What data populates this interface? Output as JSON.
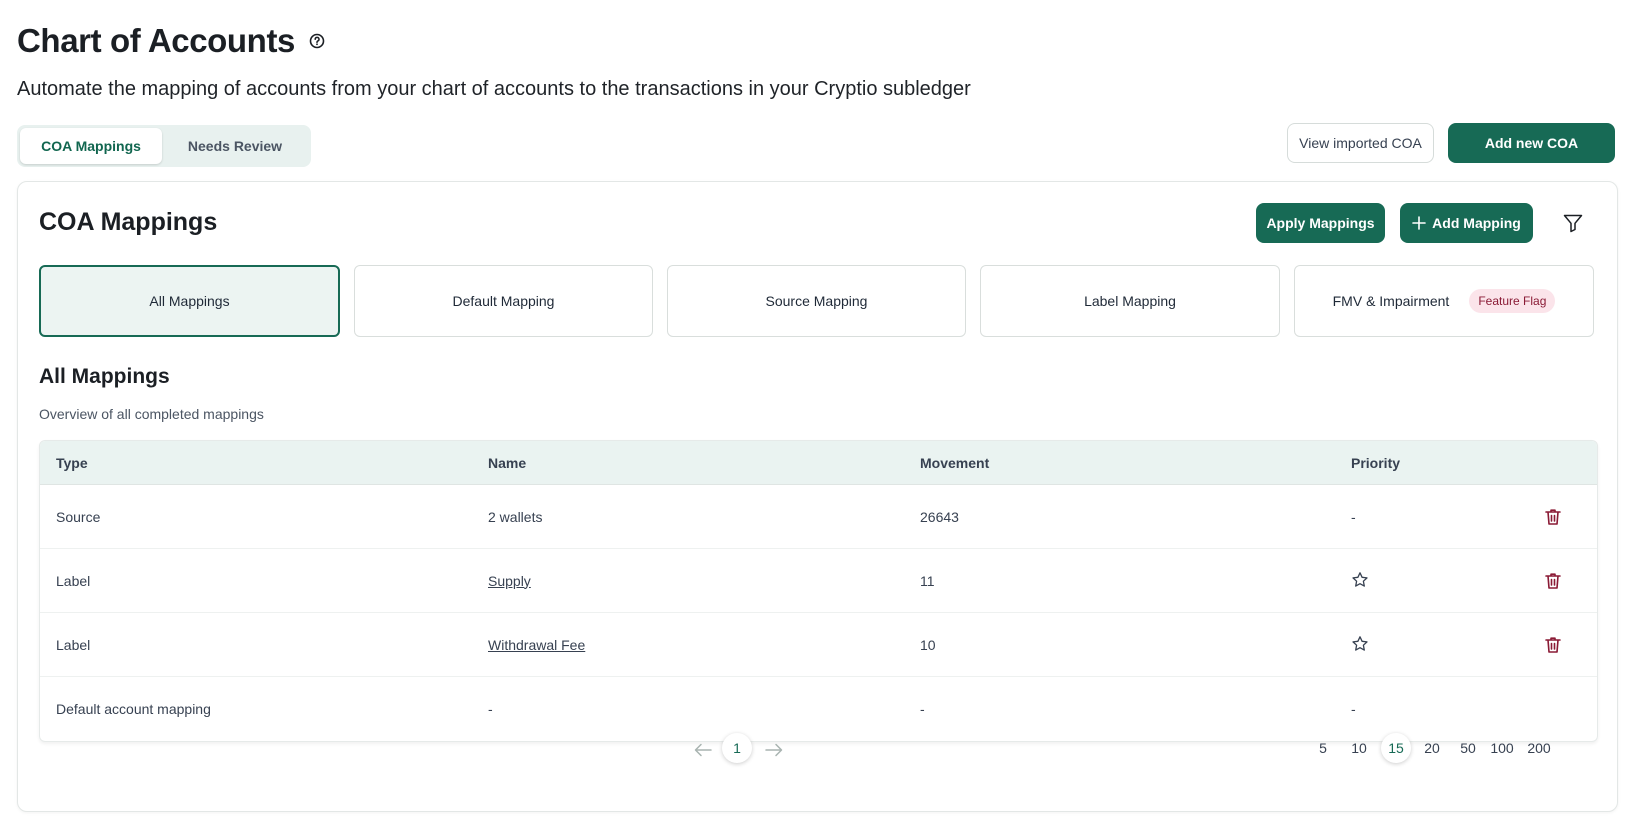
{
  "header": {
    "title": "Chart of Accounts",
    "help_icon": "question-circle-icon",
    "subtitle": "Automate the mapping of accounts from your chart of accounts to the transactions in your Cryptio subledger"
  },
  "tabs": [
    {
      "label": "COA Mappings",
      "active": true
    },
    {
      "label": "Needs Review",
      "active": false
    }
  ],
  "actions": {
    "view_imported": "View imported COA",
    "add_new": "Add new COA"
  },
  "card": {
    "title": "COA Mappings",
    "apply_label": "Apply Mappings",
    "add_mapping_label": "Add Mapping",
    "add_icon": "plus-icon",
    "filter_icon": "filter-icon"
  },
  "mapping_types": [
    {
      "label": "All Mappings",
      "active": true
    },
    {
      "label": "Default Mapping",
      "active": false
    },
    {
      "label": "Source Mapping",
      "active": false
    },
    {
      "label": "Label Mapping",
      "active": false
    },
    {
      "label": "FMV & Impairment",
      "active": false,
      "badge": "Feature Flag"
    }
  ],
  "section": {
    "title": "All Mappings",
    "description": "Overview of all completed mappings"
  },
  "table": {
    "columns": [
      "Type",
      "Name",
      "Movement",
      "Priority"
    ],
    "rows": [
      {
        "type": "Source",
        "name": "2 wallets",
        "movement": "26643",
        "priority": "-",
        "priority_icon": null,
        "deletable": true,
        "name_link": false
      },
      {
        "type": "Label",
        "name": "Supply",
        "movement": "11",
        "priority": "",
        "priority_icon": "star-icon",
        "deletable": true,
        "name_link": true
      },
      {
        "type": "Label",
        "name": "Withdrawal Fee",
        "movement": "10",
        "priority": "",
        "priority_icon": "star-icon",
        "deletable": true,
        "name_link": true
      },
      {
        "type": "Default account mapping",
        "name": "-",
        "movement": "-",
        "priority": "-",
        "priority_icon": null,
        "deletable": false,
        "name_link": false
      }
    ]
  },
  "pagination": {
    "current_page": "1",
    "page_sizes": [
      "5",
      "10",
      "15",
      "20",
      "50",
      "100",
      "200"
    ],
    "selected_size": "15"
  },
  "colors": {
    "primary": "#176a55",
    "danger": "#8a1a35",
    "tab_bg": "#e8f1ef"
  }
}
